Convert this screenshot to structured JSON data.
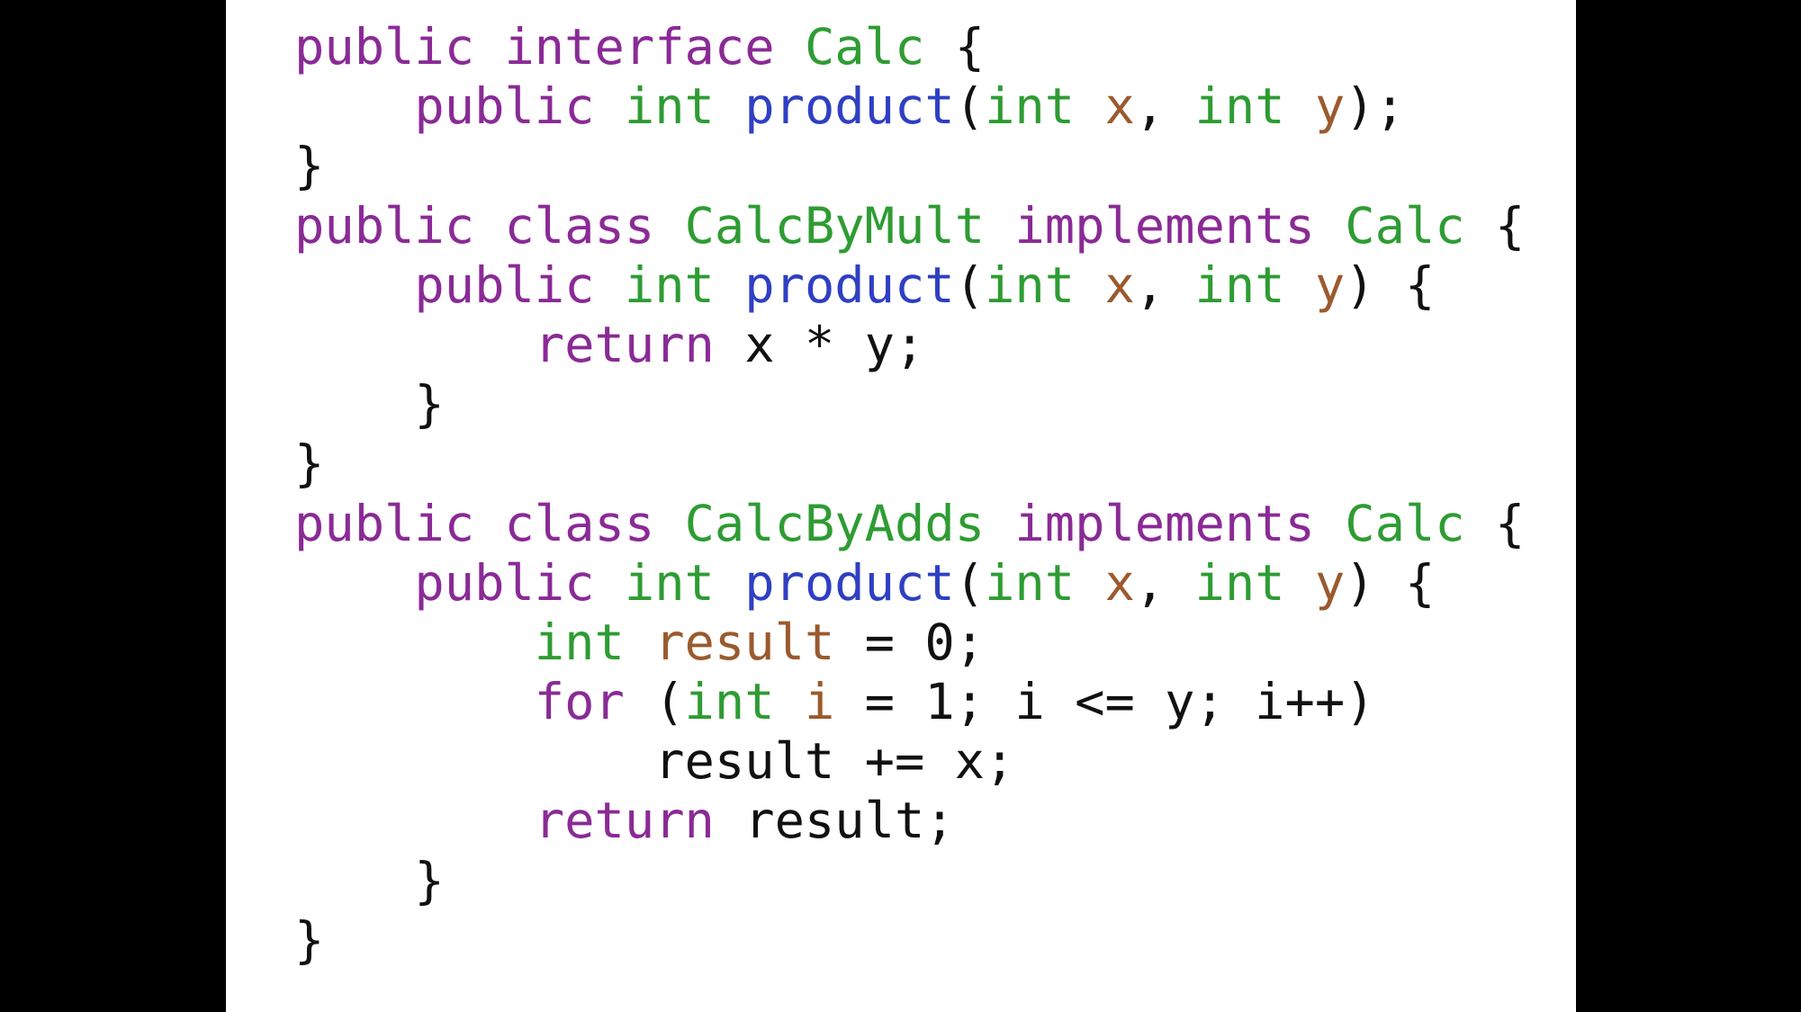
{
  "colors": {
    "background": "#000000",
    "slide": "#ffffff",
    "keyword": "#8a2a96",
    "type": "#2e9c33",
    "function": "#2f3fc3",
    "variable": "#9a5a2e",
    "plain": "#111111"
  },
  "code": {
    "language": "java",
    "lines": [
      [
        [
          "kw",
          "public"
        ],
        [
          "pl",
          " "
        ],
        [
          "kw",
          "interface"
        ],
        [
          "pl",
          " "
        ],
        [
          "ty",
          "Calc"
        ],
        [
          "pl",
          " {"
        ]
      ],
      [
        [
          "pl",
          "    "
        ],
        [
          "kw",
          "public"
        ],
        [
          "pl",
          " "
        ],
        [
          "ty",
          "int"
        ],
        [
          "pl",
          " "
        ],
        [
          "fn",
          "product"
        ],
        [
          "pl",
          "("
        ],
        [
          "ty",
          "int"
        ],
        [
          "pl",
          " "
        ],
        [
          "var",
          "x"
        ],
        [
          "pl",
          ", "
        ],
        [
          "ty",
          "int"
        ],
        [
          "pl",
          " "
        ],
        [
          "var",
          "y"
        ],
        [
          "pl",
          ");"
        ]
      ],
      [
        [
          "pl",
          "}"
        ]
      ],
      [
        [
          "kw",
          "public"
        ],
        [
          "pl",
          " "
        ],
        [
          "kw",
          "class"
        ],
        [
          "pl",
          " "
        ],
        [
          "ty",
          "CalcByMult"
        ],
        [
          "pl",
          " "
        ],
        [
          "kw",
          "implements"
        ],
        [
          "pl",
          " "
        ],
        [
          "ty",
          "Calc"
        ],
        [
          "pl",
          " {"
        ]
      ],
      [
        [
          "pl",
          "    "
        ],
        [
          "kw",
          "public"
        ],
        [
          "pl",
          " "
        ],
        [
          "ty",
          "int"
        ],
        [
          "pl",
          " "
        ],
        [
          "fn",
          "product"
        ],
        [
          "pl",
          "("
        ],
        [
          "ty",
          "int"
        ],
        [
          "pl",
          " "
        ],
        [
          "var",
          "x"
        ],
        [
          "pl",
          ", "
        ],
        [
          "ty",
          "int"
        ],
        [
          "pl",
          " "
        ],
        [
          "var",
          "y"
        ],
        [
          "pl",
          ") {"
        ]
      ],
      [
        [
          "pl",
          "        "
        ],
        [
          "kw",
          "return"
        ],
        [
          "pl",
          " x * y;"
        ]
      ],
      [
        [
          "pl",
          "    }"
        ]
      ],
      [
        [
          "pl",
          "}"
        ]
      ],
      [
        [
          "kw",
          "public"
        ],
        [
          "pl",
          " "
        ],
        [
          "kw",
          "class"
        ],
        [
          "pl",
          " "
        ],
        [
          "ty",
          "CalcByAdds"
        ],
        [
          "pl",
          " "
        ],
        [
          "kw",
          "implements"
        ],
        [
          "pl",
          " "
        ],
        [
          "ty",
          "Calc"
        ],
        [
          "pl",
          " {"
        ]
      ],
      [
        [
          "pl",
          "    "
        ],
        [
          "kw",
          "public"
        ],
        [
          "pl",
          " "
        ],
        [
          "ty",
          "int"
        ],
        [
          "pl",
          " "
        ],
        [
          "fn",
          "product"
        ],
        [
          "pl",
          "("
        ],
        [
          "ty",
          "int"
        ],
        [
          "pl",
          " "
        ],
        [
          "var",
          "x"
        ],
        [
          "pl",
          ", "
        ],
        [
          "ty",
          "int"
        ],
        [
          "pl",
          " "
        ],
        [
          "var",
          "y"
        ],
        [
          "pl",
          ") {"
        ]
      ],
      [
        [
          "pl",
          "        "
        ],
        [
          "ty",
          "int"
        ],
        [
          "pl",
          " "
        ],
        [
          "var",
          "result"
        ],
        [
          "pl",
          " = 0;"
        ]
      ],
      [
        [
          "pl",
          "        "
        ],
        [
          "kw",
          "for"
        ],
        [
          "pl",
          " ("
        ],
        [
          "ty",
          "int"
        ],
        [
          "pl",
          " "
        ],
        [
          "var",
          "i"
        ],
        [
          "pl",
          " = 1; i <= y; i++)"
        ]
      ],
      [
        [
          "pl",
          "            result += x;"
        ]
      ],
      [
        [
          "pl",
          "        "
        ],
        [
          "kw",
          "return"
        ],
        [
          "pl",
          " result;"
        ]
      ],
      [
        [
          "pl",
          "    }"
        ]
      ],
      [
        [
          "pl",
          "}"
        ]
      ]
    ]
  }
}
